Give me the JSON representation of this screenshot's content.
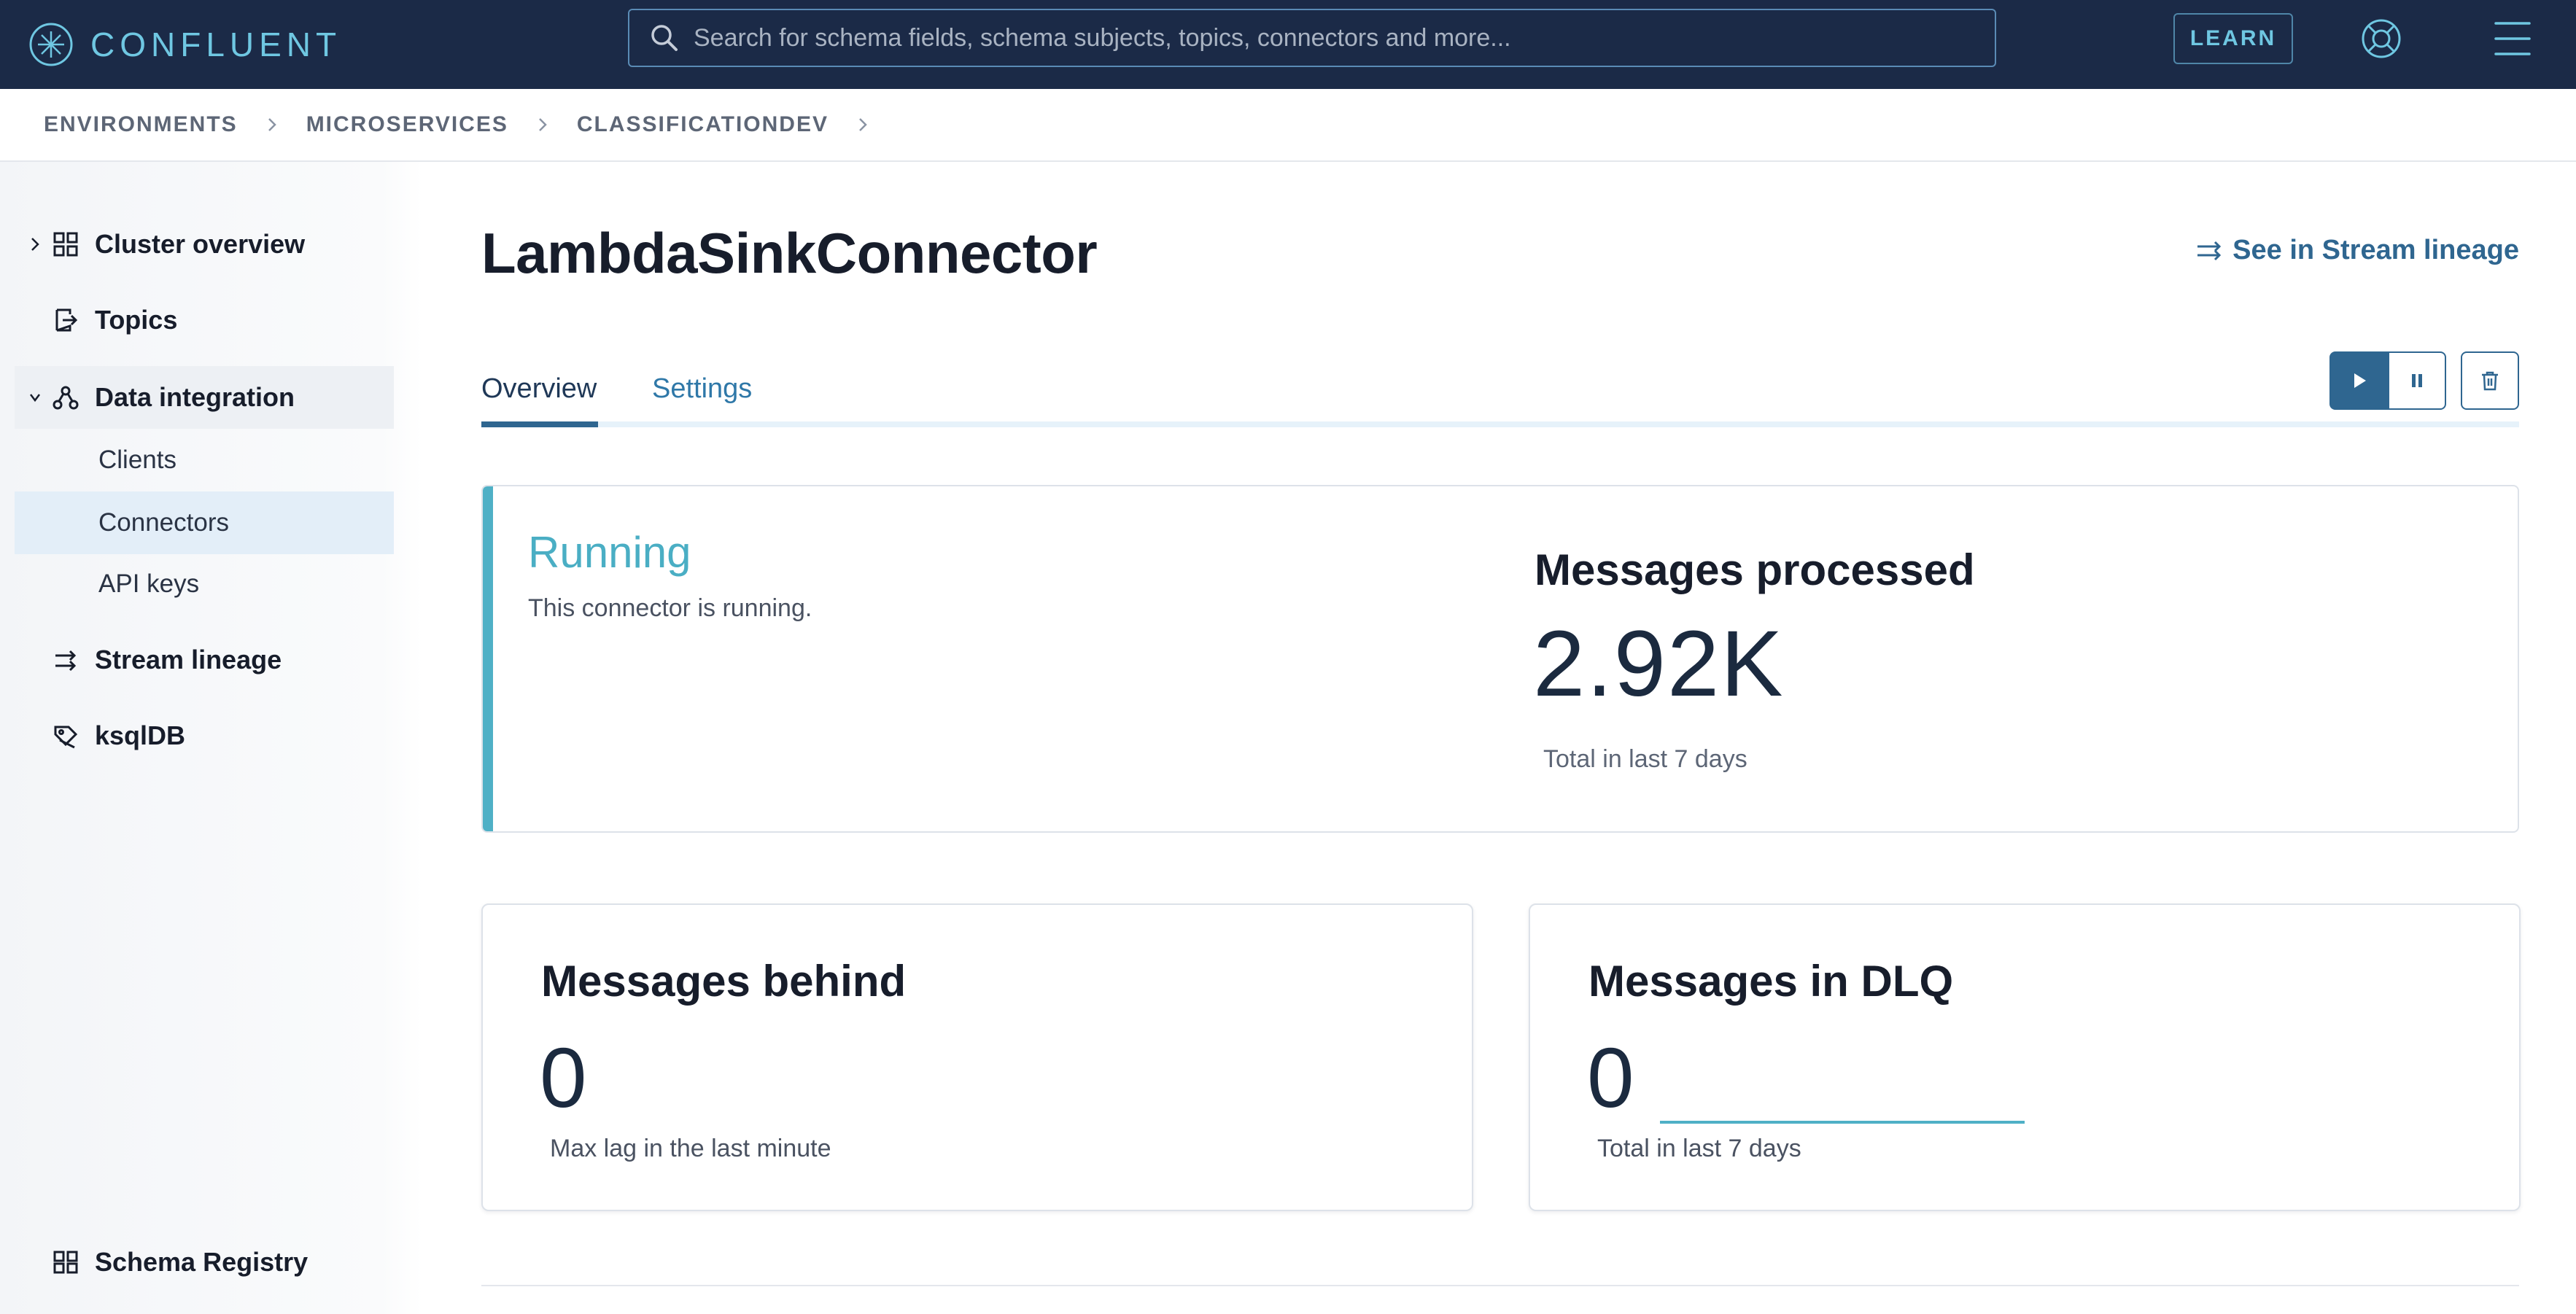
{
  "topbar": {
    "brand": "CONFLUENT",
    "search_placeholder": "Search for schema fields, schema subjects, topics, connectors and more...",
    "learn_label": "LEARN"
  },
  "breadcrumb": [
    "ENVIRONMENTS",
    "MICROSERVICES",
    "CLASSIFICATIONDEV"
  ],
  "sidebar": {
    "items": [
      {
        "label": "Cluster overview",
        "icon": "grid-icon"
      },
      {
        "label": "Topics",
        "icon": "topics-icon"
      },
      {
        "label": "Data integration",
        "icon": "integration-icon"
      },
      {
        "label": "Stream lineage",
        "icon": "lineage-icon"
      },
      {
        "label": "ksqlDB",
        "icon": "ksqldb-icon"
      },
      {
        "label": "Schema Registry",
        "icon": "schema-icon"
      }
    ],
    "sub_items": [
      {
        "label": "Clients"
      },
      {
        "label": "Connectors"
      },
      {
        "label": "API keys"
      }
    ]
  },
  "main": {
    "title": "LambdaSinkConnector",
    "lineage_link": "See in Stream lineage",
    "tabs": [
      {
        "label": "Overview"
      },
      {
        "label": "Settings"
      }
    ],
    "status": {
      "title": "Running",
      "desc": "This connector is running."
    },
    "messages_processed": {
      "title": "Messages processed",
      "value": "2.92K",
      "sub": "Total in last 7 days"
    },
    "messages_behind": {
      "title": "Messages behind",
      "value": "0",
      "sub": "Max lag in the last minute"
    },
    "messages_dlq": {
      "title": "Messages in DLQ",
      "value": "0",
      "sub": "Total in last 7 days"
    }
  },
  "colors": {
    "navbar": "#1b2a47",
    "accent": "#4fb0c6",
    "link": "#2f6690"
  }
}
